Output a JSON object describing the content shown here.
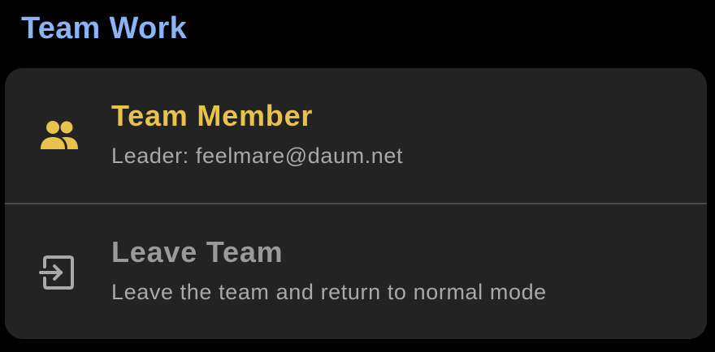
{
  "section": {
    "title": "Team Work"
  },
  "items": [
    {
      "icon": "group-icon",
      "title": "Team Member",
      "subtitle": "Leader: feelmare@daum.net",
      "title_color": "#e8c24a"
    },
    {
      "icon": "exit-icon",
      "title": "Leave Team",
      "subtitle": "Leave the team and return to normal mode",
      "title_color": "#9a9a9a"
    }
  ],
  "colors": {
    "background": "#000000",
    "card": "#232323",
    "section_title": "#8ab4f8",
    "accent": "#e8c24a",
    "muted": "#9a9a9a"
  }
}
